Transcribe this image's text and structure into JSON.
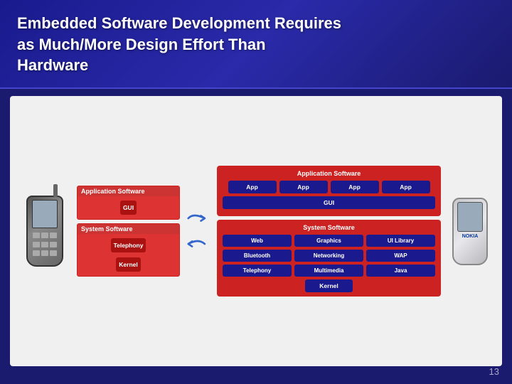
{
  "header": {
    "title_line1": "Embedded Software Development Requires",
    "title_line2": "as Much/More Design Effort Than",
    "title_line3": "Hardware"
  },
  "diagram_left": {
    "app_section_label": "Application Software",
    "gui_label": "GUI",
    "sys_section_label": "System Software",
    "telephony_label": "Telephony",
    "kernel_label": "Kernel"
  },
  "diagram_right": {
    "app_section_label": "Application Software",
    "app_boxes": [
      "App",
      "App",
      "App",
      "App"
    ],
    "gui_label": "GUI",
    "sys_section_label": "System Software",
    "sys_boxes": [
      "Web",
      "Graphics",
      "UI Library",
      "Bluetooth",
      "Networking",
      "WAP",
      "Telephony",
      "Multimedia",
      "Java"
    ],
    "kernel_label": "Kernel"
  },
  "page_number": "13",
  "phone_right_brand": "NOKIA"
}
